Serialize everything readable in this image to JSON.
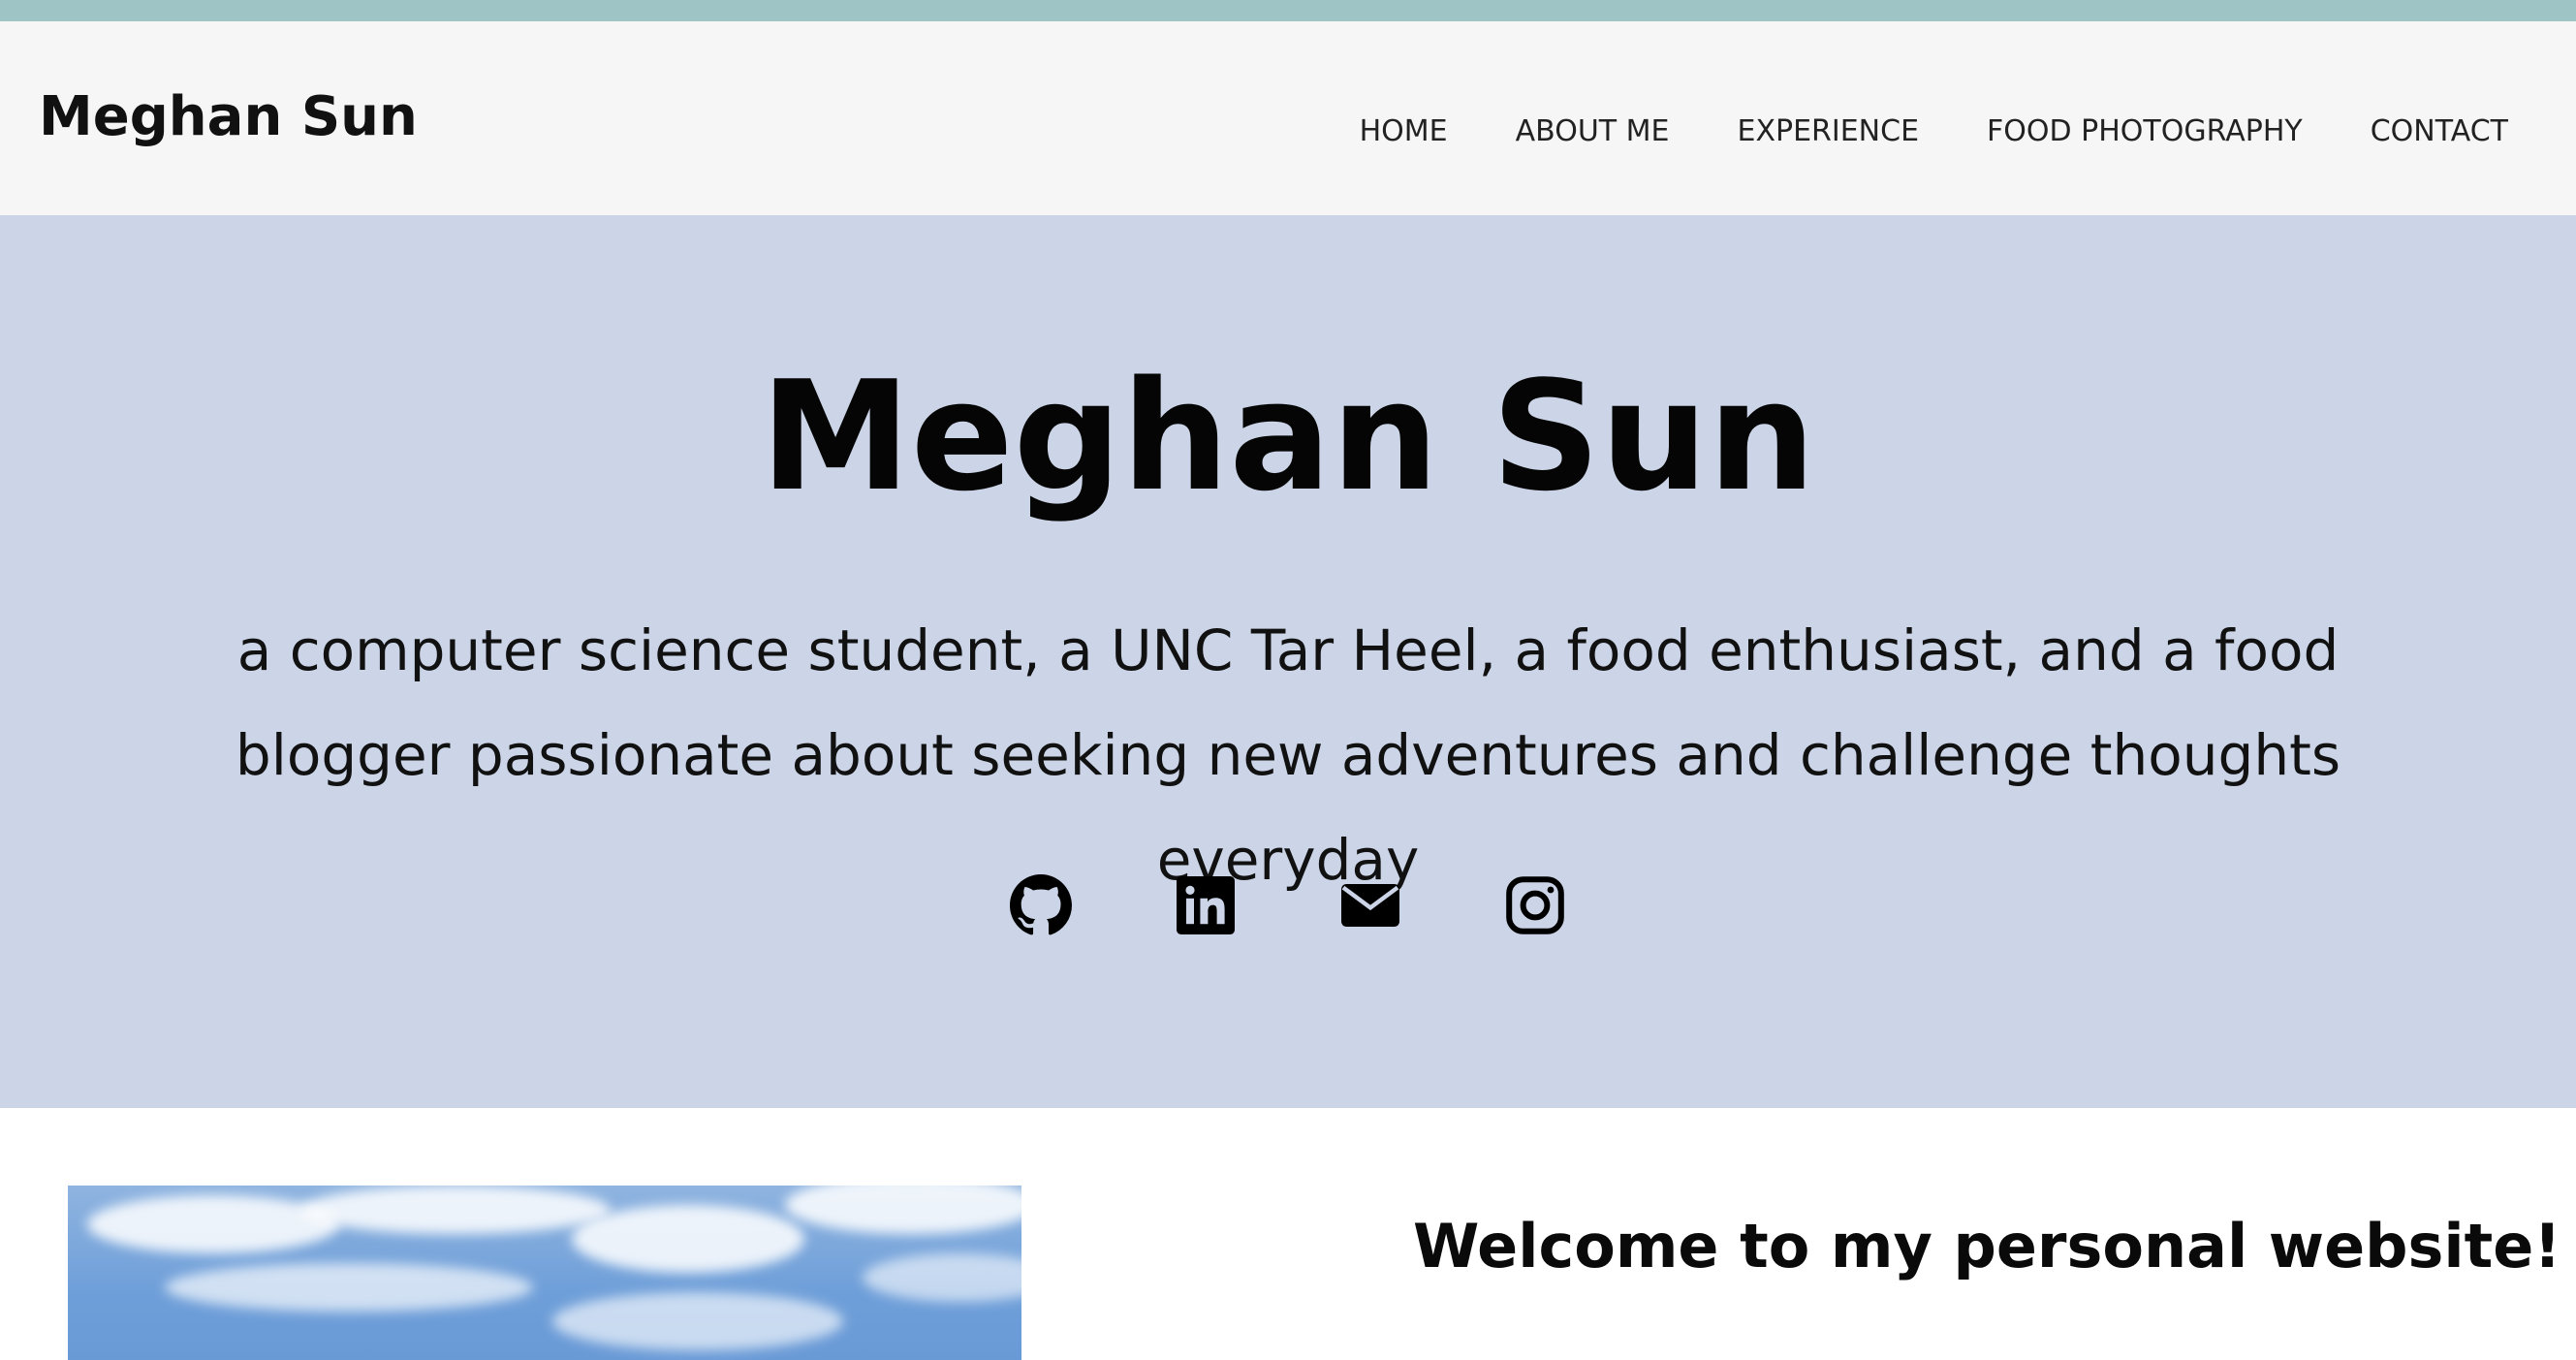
{
  "header": {
    "brand": "Meghan Sun",
    "nav": [
      {
        "label": "HOME"
      },
      {
        "label": "ABOUT ME"
      },
      {
        "label": "EXPERIENCE"
      },
      {
        "label": "FOOD PHOTOGRAPHY"
      },
      {
        "label": "CONTACT"
      }
    ]
  },
  "hero": {
    "title": "Meghan Sun",
    "tagline": "a computer science student, a UNC Tar Heel, a food enthusiast, and a food blogger passionate about seeking new adventures and challenge thoughts everyday",
    "social": [
      {
        "icon": "github-icon"
      },
      {
        "icon": "linkedin-icon"
      },
      {
        "icon": "email-icon"
      },
      {
        "icon": "instagram-icon"
      }
    ]
  },
  "content": {
    "welcome_heading": "Welcome to my personal website!"
  },
  "colors": {
    "top_stripe": "#9fc4c6",
    "navbar_bg": "#f6f6f6",
    "hero_bg": "#cbd5e7"
  }
}
